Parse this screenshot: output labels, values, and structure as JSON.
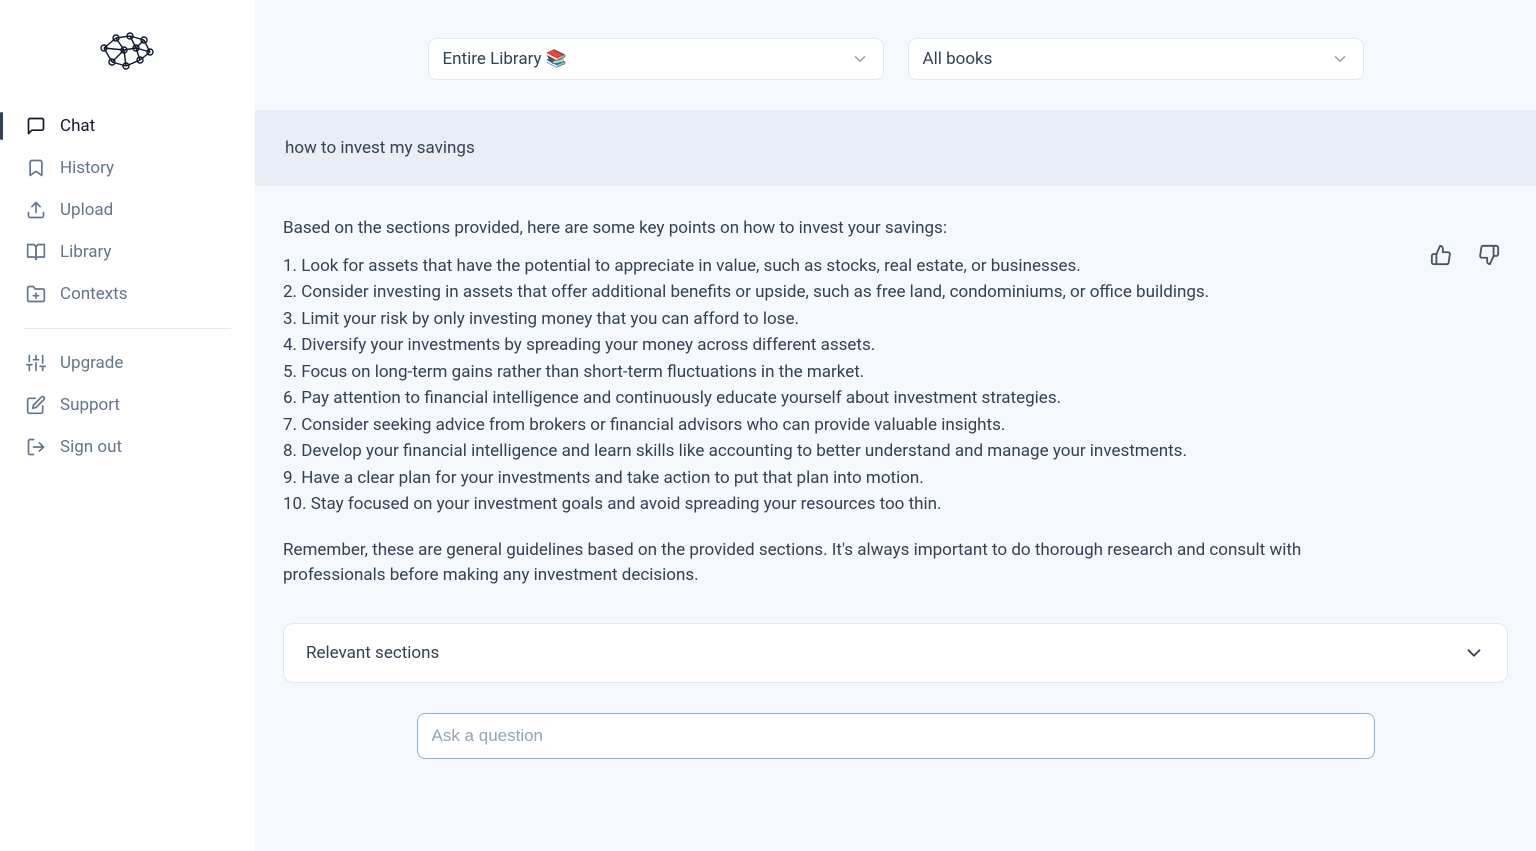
{
  "sidebar": {
    "items": [
      {
        "label": "Chat"
      },
      {
        "label": "History"
      },
      {
        "label": "Upload"
      },
      {
        "label": "Library"
      },
      {
        "label": "Contexts"
      }
    ],
    "secondary": [
      {
        "label": "Upgrade"
      },
      {
        "label": "Support"
      },
      {
        "label": "Sign out"
      }
    ]
  },
  "topbar": {
    "select1": "Entire Library 📚",
    "select2": "All books"
  },
  "query": "how to invest my savings",
  "answer": {
    "intro": "Based on the sections provided, here are some key points on how to invest your savings:",
    "points": [
      "1. Look for assets that have the potential to appreciate in value, such as stocks, real estate, or businesses.",
      "2. Consider investing in assets that offer additional benefits or upside, such as free land, condominiums, or office buildings.",
      "3. Limit your risk by only investing money that you can afford to lose.",
      "4. Diversify your investments by spreading your money across different assets.",
      "5. Focus on long-term gains rather than short-term fluctuations in the market.",
      "6. Pay attention to financial intelligence and continuously educate yourself about investment strategies.",
      "7. Consider seeking advice from brokers or financial advisors who can provide valuable insights.",
      "8. Develop your financial intelligence and learn skills like accounting to better understand and manage your investments.",
      "9. Have a clear plan for your investments and take action to put that plan into motion.",
      "10. Stay focused on your investment goals and avoid spreading your resources too thin."
    ],
    "outro": "Remember, these are general guidelines based on the provided sections. It's always important to do thorough research and consult with professionals before making any investment decisions."
  },
  "relevant_sections_label": "Relevant sections",
  "input_placeholder": "Ask a question"
}
